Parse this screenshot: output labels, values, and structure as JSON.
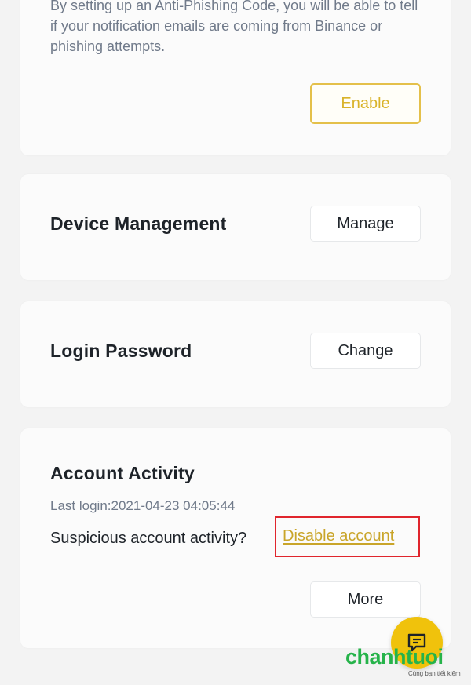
{
  "anti_phishing": {
    "description": "By setting up an Anti-Phishing Code, you will be able to tell if your notification emails are coming from Binance or phishing attempts.",
    "enable_label": "Enable"
  },
  "device_management": {
    "title": "Device Management",
    "button_label": "Manage"
  },
  "login_password": {
    "title": "Login Password",
    "button_label": "Change"
  },
  "account_activity": {
    "title": "Account Activity",
    "last_login": "Last login:2021-04-23 04:05:44",
    "suspicious_text": "Suspicious account activity?",
    "disable_link": "Disable account",
    "more_label": "More"
  },
  "watermark": {
    "brand": "chanhtuoi",
    "tagline": "Cùng bạn tiết kiệm"
  },
  "colors": {
    "accent_yellow": "#f0c20c",
    "highlight_red": "#e0252d",
    "brand_green": "#26b34a"
  },
  "icons": {
    "chat": "chat-bubble-icon"
  }
}
